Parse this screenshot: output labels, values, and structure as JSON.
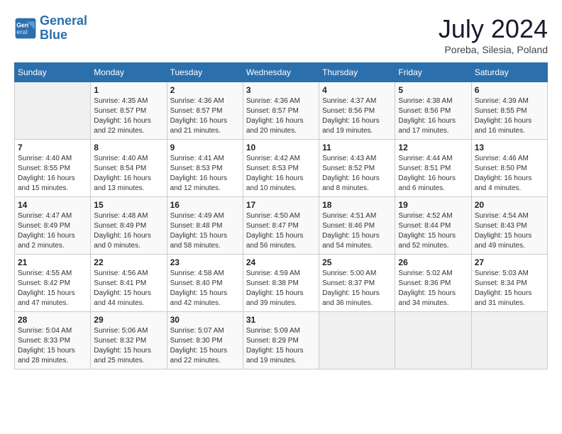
{
  "logo": {
    "line1": "General",
    "line2": "Blue"
  },
  "title": "July 2024",
  "location": "Poreba, Silesia, Poland",
  "days_of_week": [
    "Sunday",
    "Monday",
    "Tuesday",
    "Wednesday",
    "Thursday",
    "Friday",
    "Saturday"
  ],
  "weeks": [
    [
      {
        "day": "",
        "info": ""
      },
      {
        "day": "1",
        "info": "Sunrise: 4:35 AM\nSunset: 8:57 PM\nDaylight: 16 hours\nand 22 minutes."
      },
      {
        "day": "2",
        "info": "Sunrise: 4:36 AM\nSunset: 8:57 PM\nDaylight: 16 hours\nand 21 minutes."
      },
      {
        "day": "3",
        "info": "Sunrise: 4:36 AM\nSunset: 8:57 PM\nDaylight: 16 hours\nand 20 minutes."
      },
      {
        "day": "4",
        "info": "Sunrise: 4:37 AM\nSunset: 8:56 PM\nDaylight: 16 hours\nand 19 minutes."
      },
      {
        "day": "5",
        "info": "Sunrise: 4:38 AM\nSunset: 8:56 PM\nDaylight: 16 hours\nand 17 minutes."
      },
      {
        "day": "6",
        "info": "Sunrise: 4:39 AM\nSunset: 8:55 PM\nDaylight: 16 hours\nand 16 minutes."
      }
    ],
    [
      {
        "day": "7",
        "info": "Sunrise: 4:40 AM\nSunset: 8:55 PM\nDaylight: 16 hours\nand 15 minutes."
      },
      {
        "day": "8",
        "info": "Sunrise: 4:40 AM\nSunset: 8:54 PM\nDaylight: 16 hours\nand 13 minutes."
      },
      {
        "day": "9",
        "info": "Sunrise: 4:41 AM\nSunset: 8:53 PM\nDaylight: 16 hours\nand 12 minutes."
      },
      {
        "day": "10",
        "info": "Sunrise: 4:42 AM\nSunset: 8:53 PM\nDaylight: 16 hours\nand 10 minutes."
      },
      {
        "day": "11",
        "info": "Sunrise: 4:43 AM\nSunset: 8:52 PM\nDaylight: 16 hours\nand 8 minutes."
      },
      {
        "day": "12",
        "info": "Sunrise: 4:44 AM\nSunset: 8:51 PM\nDaylight: 16 hours\nand 6 minutes."
      },
      {
        "day": "13",
        "info": "Sunrise: 4:46 AM\nSunset: 8:50 PM\nDaylight: 16 hours\nand 4 minutes."
      }
    ],
    [
      {
        "day": "14",
        "info": "Sunrise: 4:47 AM\nSunset: 8:49 PM\nDaylight: 16 hours\nand 2 minutes."
      },
      {
        "day": "15",
        "info": "Sunrise: 4:48 AM\nSunset: 8:49 PM\nDaylight: 16 hours\nand 0 minutes."
      },
      {
        "day": "16",
        "info": "Sunrise: 4:49 AM\nSunset: 8:48 PM\nDaylight: 15 hours\nand 58 minutes."
      },
      {
        "day": "17",
        "info": "Sunrise: 4:50 AM\nSunset: 8:47 PM\nDaylight: 15 hours\nand 56 minutes."
      },
      {
        "day": "18",
        "info": "Sunrise: 4:51 AM\nSunset: 8:46 PM\nDaylight: 15 hours\nand 54 minutes."
      },
      {
        "day": "19",
        "info": "Sunrise: 4:52 AM\nSunset: 8:44 PM\nDaylight: 15 hours\nand 52 minutes."
      },
      {
        "day": "20",
        "info": "Sunrise: 4:54 AM\nSunset: 8:43 PM\nDaylight: 15 hours\nand 49 minutes."
      }
    ],
    [
      {
        "day": "21",
        "info": "Sunrise: 4:55 AM\nSunset: 8:42 PM\nDaylight: 15 hours\nand 47 minutes."
      },
      {
        "day": "22",
        "info": "Sunrise: 4:56 AM\nSunset: 8:41 PM\nDaylight: 15 hours\nand 44 minutes."
      },
      {
        "day": "23",
        "info": "Sunrise: 4:58 AM\nSunset: 8:40 PM\nDaylight: 15 hours\nand 42 minutes."
      },
      {
        "day": "24",
        "info": "Sunrise: 4:59 AM\nSunset: 8:38 PM\nDaylight: 15 hours\nand 39 minutes."
      },
      {
        "day": "25",
        "info": "Sunrise: 5:00 AM\nSunset: 8:37 PM\nDaylight: 15 hours\nand 36 minutes."
      },
      {
        "day": "26",
        "info": "Sunrise: 5:02 AM\nSunset: 8:36 PM\nDaylight: 15 hours\nand 34 minutes."
      },
      {
        "day": "27",
        "info": "Sunrise: 5:03 AM\nSunset: 8:34 PM\nDaylight: 15 hours\nand 31 minutes."
      }
    ],
    [
      {
        "day": "28",
        "info": "Sunrise: 5:04 AM\nSunset: 8:33 PM\nDaylight: 15 hours\nand 28 minutes."
      },
      {
        "day": "29",
        "info": "Sunrise: 5:06 AM\nSunset: 8:32 PM\nDaylight: 15 hours\nand 25 minutes."
      },
      {
        "day": "30",
        "info": "Sunrise: 5:07 AM\nSunset: 8:30 PM\nDaylight: 15 hours\nand 22 minutes."
      },
      {
        "day": "31",
        "info": "Sunrise: 5:09 AM\nSunset: 8:29 PM\nDaylight: 15 hours\nand 19 minutes."
      },
      {
        "day": "",
        "info": ""
      },
      {
        "day": "",
        "info": ""
      },
      {
        "day": "",
        "info": ""
      }
    ]
  ]
}
